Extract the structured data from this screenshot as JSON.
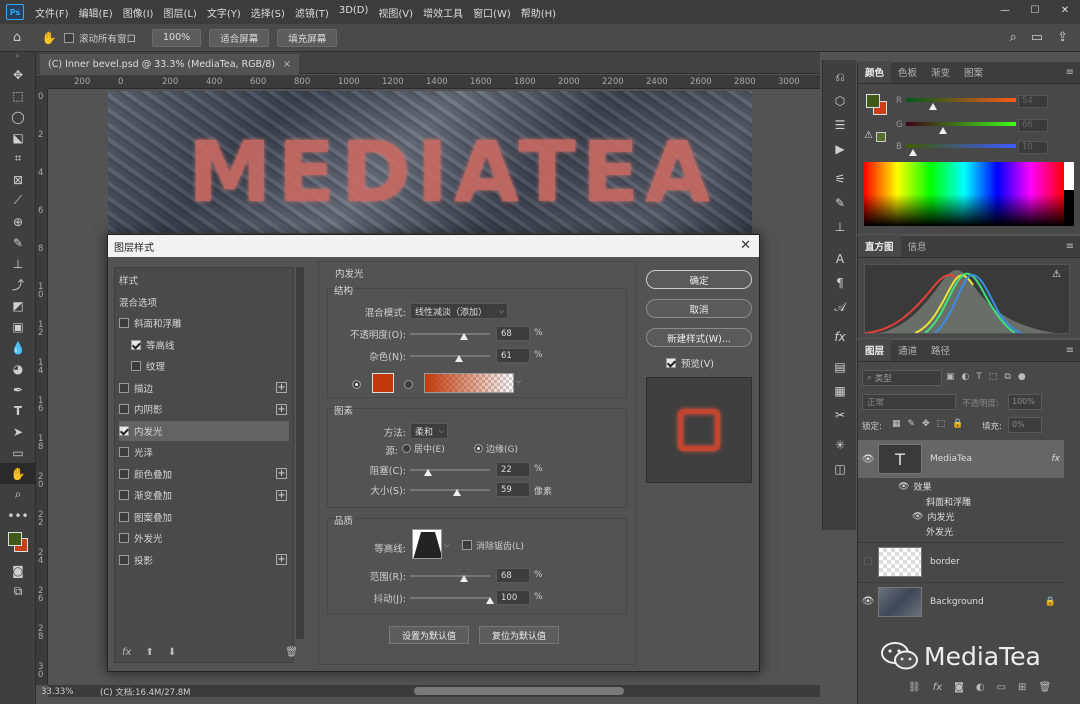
{
  "app": {
    "logo": "Ps",
    "menu": [
      "文件(F)",
      "编辑(E)",
      "图像(I)",
      "图层(L)",
      "文字(Y)",
      "选择(S)",
      "滤镜(T)",
      "3D(D)",
      "视图(V)",
      "增效工具",
      "窗口(W)",
      "帮助(H)"
    ],
    "window_controls": [
      "—",
      "☐",
      "✕"
    ]
  },
  "options": {
    "scroll_all_label": "滚动所有窗口",
    "zoom_value": "100%",
    "fit_screen": "适合屏幕",
    "fill_screen": "填充屏幕"
  },
  "document": {
    "tab_title": "(C) Inner bevel.psd @ 33.3% (MediaTea, RGB/8)",
    "tab_close": "×",
    "ruler_h": [
      "200",
      "0",
      "200",
      "400",
      "600",
      "800",
      "1000",
      "1200",
      "1400",
      "1600",
      "1800",
      "2000",
      "2200",
      "2400",
      "2600",
      "2800",
      "3000"
    ],
    "ruler_v": [
      "0",
      "2",
      "4",
      "6",
      "8",
      "1 0",
      "1 2",
      "1 4",
      "1 6",
      "1 8",
      "2 0",
      "2 2",
      "2 4",
      "2 6",
      "2 8",
      "3 0"
    ],
    "canvas_text": "MEDIATEA",
    "status_zoom": "33.33%",
    "status_doc": "(C) 文档:16.4M/27.8M"
  },
  "color_panel": {
    "tabs": [
      "颜色",
      "色板",
      "渐变",
      "图案"
    ],
    "active_tab": 0,
    "channels": [
      {
        "letter": "R",
        "value": "54"
      },
      {
        "letter": "G",
        "value": "66"
      },
      {
        "letter": "B",
        "value": "10"
      }
    ],
    "foreground": "#3f5a19",
    "background": "#c8401a"
  },
  "histogram_panel": {
    "tabs": [
      "直方图",
      "信息"
    ],
    "active_tab": 0
  },
  "layers_panel": {
    "tabs": [
      "图层",
      "通道",
      "路径"
    ],
    "active_tab": 0,
    "search_placeholder": "类型",
    "blend_mode": "正常",
    "opacity_label": "不透明度:",
    "opacity_value": "100%",
    "lock_label": "锁定:",
    "fill_label": "填充:",
    "fill_value": "0%",
    "layers": [
      {
        "name": "MediaTea",
        "type": "text",
        "fx": "fx",
        "effects_label": "效果",
        "effects": [
          "斜面和浮雕",
          "内发光",
          "外发光"
        ]
      },
      {
        "name": "border",
        "type": "pixel"
      },
      {
        "name": "Background",
        "type": "background"
      }
    ]
  },
  "dialog": {
    "title": "图层样式",
    "close": "✕",
    "styles": [
      {
        "label": "样式",
        "type": "header"
      },
      {
        "label": "混合选项",
        "type": "header"
      },
      {
        "label": "斜面和浮雕",
        "checked": false
      },
      {
        "label": "等高线",
        "checked": true,
        "indent": true
      },
      {
        "label": "纹理",
        "checked": false,
        "indent": true
      },
      {
        "label": "描边",
        "checked": false,
        "plus": true
      },
      {
        "label": "内阴影",
        "checked": false,
        "plus": true
      },
      {
        "label": "内发光",
        "checked": true,
        "selected": true
      },
      {
        "label": "光泽",
        "checked": false
      },
      {
        "label": "颜色叠加",
        "checked": false,
        "plus": true
      },
      {
        "label": "渐变叠加",
        "checked": false,
        "plus": true
      },
      {
        "label": "图案叠加",
        "checked": false
      },
      {
        "label": "外发光",
        "checked": false
      },
      {
        "label": "投影",
        "checked": false,
        "plus": true
      }
    ],
    "footer_icons": [
      "fx",
      "⬆",
      "⬇",
      "🗑"
    ],
    "panel_title": "内发光",
    "structure": {
      "title": "结构",
      "blend_label": "混合模式:",
      "blend_value": "线性减淡（添加）",
      "opacity_label": "不透明度(O):",
      "opacity": 68,
      "noise_label": "杂色(N):",
      "noise": 61,
      "unit": "%",
      "glow_color": "#c0390c"
    },
    "elements": {
      "title": "图素",
      "method_label": "方法:",
      "method_value": "柔和",
      "source_label": "源:",
      "source_center": "居中(E)",
      "source_edge": "边缘(G)",
      "choke_label": "阻塞(C):",
      "choke": 22,
      "size_label": "大小(S):",
      "size": 59,
      "size_unit": "像素"
    },
    "quality": {
      "title": "品质",
      "contour_label": "等高线:",
      "antialias_label": "消除锯齿(L)",
      "range_label": "范围(R):",
      "range": 68,
      "jitter_label": "抖动(J):",
      "jitter": 100
    },
    "btn_set_default": "设置为默认值",
    "btn_reset_default": "复位为默认值",
    "btn_ok": "确定",
    "btn_cancel": "取消",
    "btn_new_style": "新建样式(W)...",
    "preview_label": "预览(V)"
  },
  "watermark": "MediaTea"
}
